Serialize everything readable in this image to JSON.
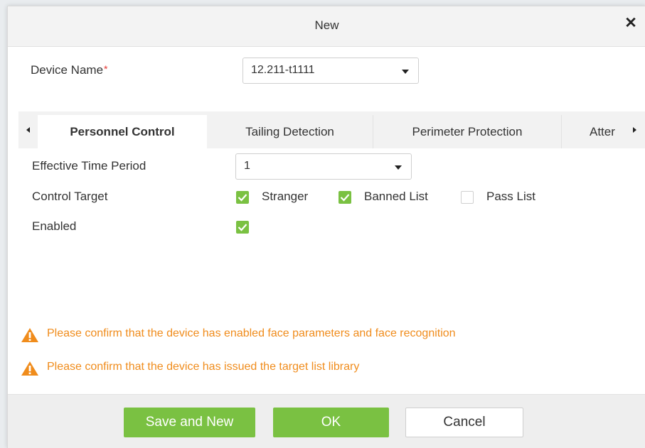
{
  "dialog": {
    "title": "New",
    "close_icon": "close-icon"
  },
  "device": {
    "label": "Device Name",
    "required_mark": "*",
    "selected": "12.211-t1111"
  },
  "tabs": [
    {
      "label": "Personnel Control",
      "active": true
    },
    {
      "label": "Tailing Detection",
      "active": false
    },
    {
      "label": "Perimeter Protection",
      "active": false
    },
    {
      "label": "Atter",
      "active": false
    }
  ],
  "form": {
    "period_label": "Effective Time Period",
    "period_value": "1",
    "target_label": "Control Target",
    "targets": [
      {
        "label": "Stranger",
        "checked": true
      },
      {
        "label": "Banned List",
        "checked": true
      },
      {
        "label": "Pass List",
        "checked": false
      }
    ],
    "enabled_label": "Enabled",
    "enabled_checked": true
  },
  "warnings": [
    "Please confirm that the device has enabled face parameters and face recognition",
    "Please confirm that the device has issued the target list library"
  ],
  "buttons": {
    "save_new": "Save and New",
    "ok": "OK",
    "cancel": "Cancel"
  },
  "colors": {
    "accent_green": "#7ac142",
    "warning_orange": "#f08c1c",
    "required_red": "#e53935"
  }
}
